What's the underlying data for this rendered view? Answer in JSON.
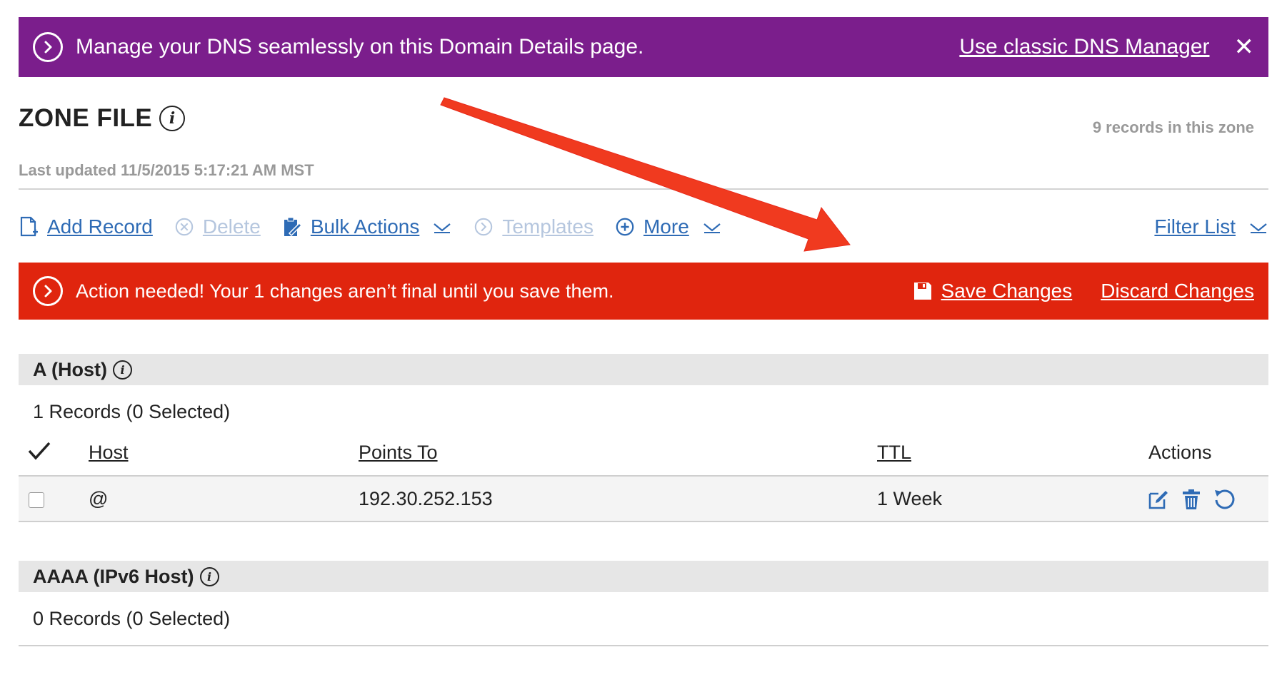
{
  "banner": {
    "message": "Manage your DNS seamlessly on this Domain Details page.",
    "link": "Use classic DNS Manager",
    "close": "✕"
  },
  "zone": {
    "title": "ZONE FILE",
    "records_in_zone": "9 records in this zone",
    "last_updated": "Last updated 11/5/2015 5:17:21 AM MST"
  },
  "toolbar": {
    "add_record": "Add Record",
    "delete": "Delete",
    "bulk_actions": "Bulk Actions",
    "templates": "Templates",
    "more": "More",
    "filter_list": "Filter List"
  },
  "alert": {
    "message": "Action needed! Your 1 changes aren’t final until you save them.",
    "save": "Save Changes",
    "discard": "Discard Changes"
  },
  "sections": [
    {
      "title": "A (Host)",
      "count": "1 Records (0 Selected)",
      "columns": [
        "Host",
        "Points To",
        "TTL",
        "Actions"
      ],
      "rows": [
        {
          "host": "@",
          "points_to": "192.30.252.153",
          "ttl": "1 Week"
        }
      ]
    },
    {
      "title": "AAAA (IPv6 Host)",
      "count": "0 Records (0 Selected)"
    }
  ],
  "colors": {
    "banner_purple": "#7b1e8c",
    "alert_red": "#e0250e",
    "link_blue": "#2e6bb5",
    "disabled_blue": "#b5c6de",
    "annotation_arrow": "#f03a1f"
  }
}
